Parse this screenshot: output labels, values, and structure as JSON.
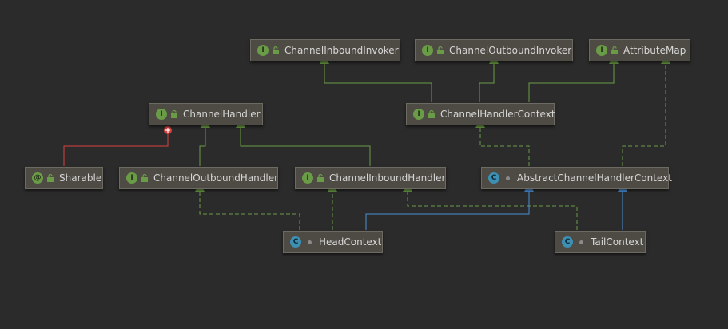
{
  "nodes": {
    "channel_inbound_invoker": {
      "label": "ChannelInboundInvoker",
      "kind": "I"
    },
    "channel_outbound_invoker": {
      "label": "ChannelOutboundInvoker",
      "kind": "I"
    },
    "attribute_map": {
      "label": "AttributeMap",
      "kind": "I"
    },
    "channel_handler": {
      "label": "ChannelHandler",
      "kind": "I"
    },
    "channel_handler_context": {
      "label": "ChannelHandlerContext",
      "kind": "I"
    },
    "sharable": {
      "label": "Sharable",
      "kind": "@"
    },
    "channel_outbound_handler": {
      "label": "ChannelOutboundHandler",
      "kind": "I"
    },
    "channel_inbound_handler": {
      "label": "ChannelInboundHandler",
      "kind": "I"
    },
    "abstract_channel_handler_context": {
      "label": "AbstractChannelHandlerContext",
      "kind": "C"
    },
    "head_context": {
      "label": "HeadContext",
      "kind": "C"
    },
    "tail_context": {
      "label": "TailContext",
      "kind": "C"
    }
  },
  "relations": [
    {
      "from": "channel_handler_context",
      "to": "channel_inbound_invoker",
      "type": "extends"
    },
    {
      "from": "channel_handler_context",
      "to": "channel_outbound_invoker",
      "type": "extends"
    },
    {
      "from": "channel_handler_context",
      "to": "attribute_map",
      "type": "extends"
    },
    {
      "from": "sharable",
      "to": "channel_handler",
      "type": "inner"
    },
    {
      "from": "channel_outbound_handler",
      "to": "channel_handler",
      "type": "extends"
    },
    {
      "from": "channel_inbound_handler",
      "to": "channel_handler",
      "type": "extends"
    },
    {
      "from": "abstract_channel_handler_context",
      "to": "channel_handler_context",
      "type": "implements"
    },
    {
      "from": "abstract_channel_handler_context",
      "to": "attribute_map",
      "type": "implements"
    },
    {
      "from": "head_context",
      "to": "channel_outbound_handler",
      "type": "implements"
    },
    {
      "from": "head_context",
      "to": "channel_inbound_handler",
      "type": "implements"
    },
    {
      "from": "head_context",
      "to": "abstract_channel_handler_context",
      "type": "extends-class"
    },
    {
      "from": "tail_context",
      "to": "channel_inbound_handler",
      "type": "implements"
    },
    {
      "from": "tail_context",
      "to": "abstract_channel_handler_context",
      "type": "extends-class"
    }
  ],
  "colors": {
    "background": "#2b2b2b",
    "interface_edge": "#6a9b47",
    "class_edge": "#4b8fd6",
    "inner_edge": "#d9403f"
  }
}
